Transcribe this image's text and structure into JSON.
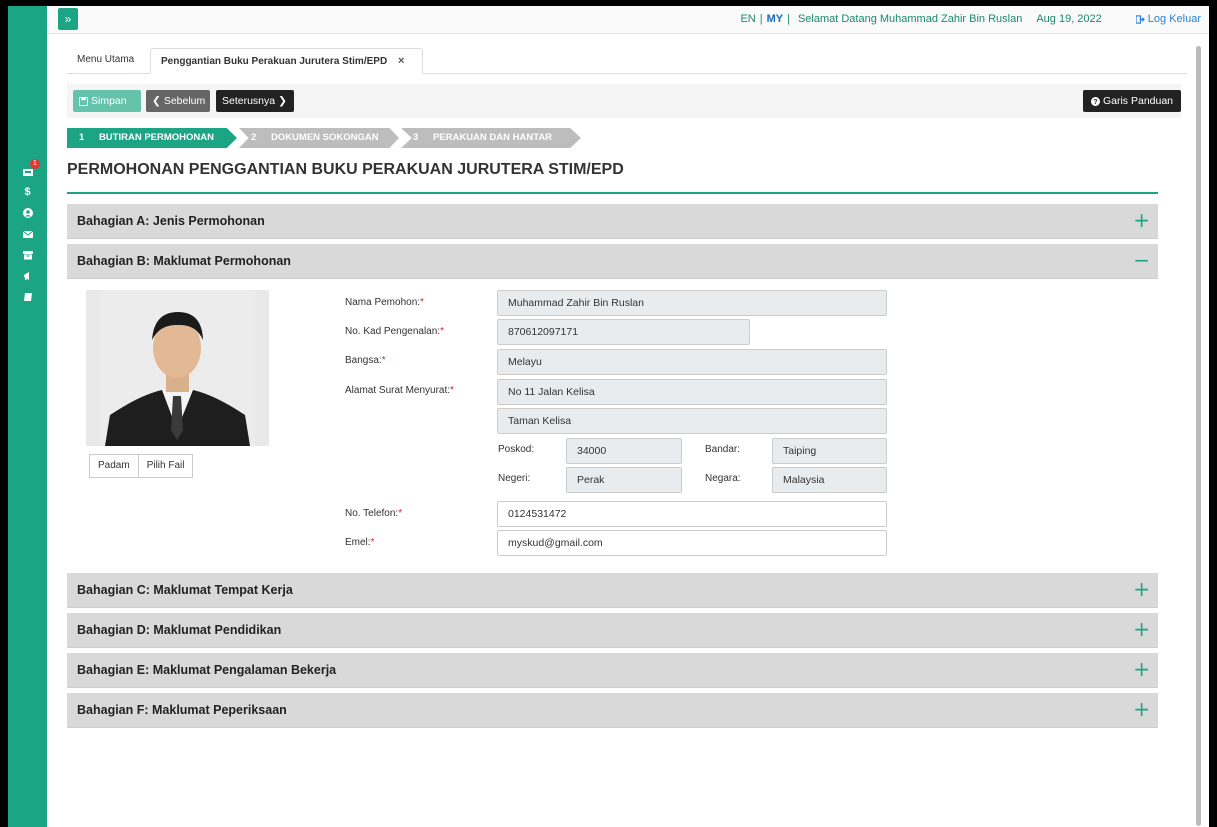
{
  "topbar": {
    "lang_en": "EN",
    "lang_my": "MY",
    "separator": "|",
    "welcome": "Selamat Datang Muhammad Zahir Bin Ruslan",
    "date": "Aug 19, 2022",
    "logout": "Log Keluar"
  },
  "sidebar": {
    "toggle": "»",
    "items": [
      {
        "icon": "inbox-icon",
        "badge": "1"
      },
      {
        "icon": "dollar-icon",
        "glyph": "$"
      },
      {
        "icon": "user-circle-icon"
      },
      {
        "icon": "envelope-icon"
      },
      {
        "icon": "archive-icon"
      },
      {
        "icon": "megaphone-icon"
      },
      {
        "icon": "book-icon"
      }
    ]
  },
  "tabs": {
    "menu": "Menu Utama",
    "active": "Penggantian Buku Perakuan Jurutera Stim/EPD",
    "close": "×"
  },
  "toolbar": {
    "save": "Simpan",
    "prev": "Sebelum",
    "next": "Seterusnya",
    "guide": "Garis Panduan"
  },
  "steps": [
    {
      "num": "1",
      "label": "BUTIRAN PERMOHONAN"
    },
    {
      "num": "2",
      "label": "DOKUMEN SOKONGAN"
    },
    {
      "num": "3",
      "label": "PERAKUAN DAN HANTAR"
    }
  ],
  "page_title": "PERMOHONAN PENGGANTIAN BUKU PERAKUAN JURUTERA STIM/EPD",
  "sections": {
    "a": {
      "label": "Bahagian A: Jenis Permohonan",
      "toggle": "+"
    },
    "b": {
      "label": "Bahagian B: Maklumat Permohonan",
      "toggle": "−"
    },
    "c": {
      "label": "Bahagian C: Maklumat Tempat Kerja",
      "toggle": "+"
    },
    "d": {
      "label": "Bahagian D: Maklumat Pendidikan",
      "toggle": "+"
    },
    "e": {
      "label": "Bahagian E: Maklumat Pengalaman Bekerja",
      "toggle": "+"
    },
    "f": {
      "label": "Bahagian F: Maklumat Peperiksaan",
      "toggle": "+"
    }
  },
  "photo": {
    "delete": "Padam",
    "choose": "Pilih Fail"
  },
  "form": {
    "required_mark": "*",
    "name_label": "Nama Pemohon:",
    "name": "Muhammad Zahir Bin Ruslan",
    "ic_label": "No. Kad Pengenalan:",
    "ic": "870612097171",
    "race_label": "Bangsa:",
    "race": "Melayu",
    "address_label": "Alamat Surat Menyurat:",
    "address1": "No 11 Jalan Kelisa",
    "address2": "Taman Kelisa",
    "postcode_label": "Poskod:",
    "postcode": "34000",
    "city_label": "Bandar:",
    "city": "Taiping",
    "state_label": "Negeri:",
    "state": "Perak",
    "country_label": "Negara:",
    "country": "Malaysia",
    "phone_label": "No. Telefon:",
    "phone": "0124531472",
    "email_label": "Emel:",
    "email": "myskud@gmail.com"
  }
}
